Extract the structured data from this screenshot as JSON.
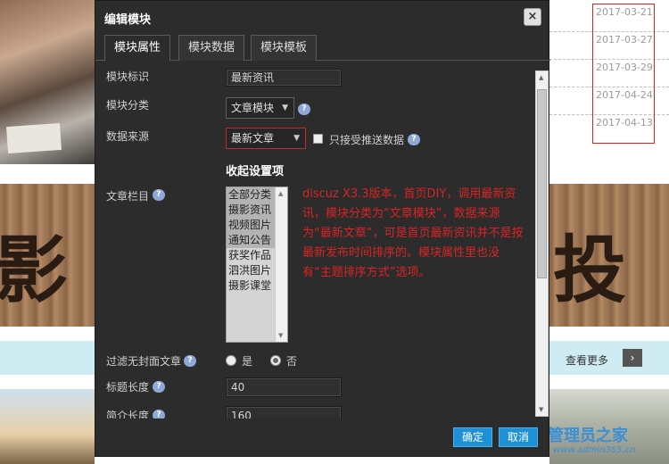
{
  "background": {
    "dates": [
      "2017-03-21",
      "2017-03-27",
      "2017-03-29",
      "2017-04-24",
      "2017-04-13"
    ],
    "banner_chars": [
      "影",
      "〔",
      "投"
    ],
    "more_link": "查看更多",
    "more_icon": "chevron-right-icon",
    "watermark": "管理员之家",
    "watermark_url": "www.admin365.cn"
  },
  "dialog": {
    "title": "编辑模块",
    "close_icon": "close-icon",
    "tabs": [
      {
        "label": "模块属性",
        "active": true
      },
      {
        "label": "模块数据",
        "active": false
      },
      {
        "label": "模块模板",
        "active": false
      }
    ],
    "fields": {
      "module_id_label": "模块标识",
      "module_id_value": "最新资讯",
      "category_label": "模块分类",
      "category_value": "文章模块",
      "source_label": "数据来源",
      "source_value": "最新文章",
      "push_only_label": "只接受推送数据",
      "collapse_title": "收起设置项",
      "article_column_label": "文章栏目",
      "article_columns": [
        "全部分类",
        "摄影资讯",
        "视频图片",
        "通知公告",
        "获奖作品",
        "泗洪图片",
        "摄影课堂"
      ],
      "filter_nocover_label": "过滤无封面文章",
      "radio_yes": "是",
      "radio_no": "否",
      "title_length_label": "标题长度",
      "title_length_value": "40",
      "summary_length_label": "简介长度",
      "summary_length_value": "160"
    },
    "annotation": "discuz X3.3版本，首页DIY，调用最新资讯，模块分类为“文章模块”，数据来源为“最新文章”，可是首页最新资讯并不是按最新发布时间排序的。模块属性里也没有“主题排序方式”选项。",
    "buttons": {
      "confirm": "确定",
      "cancel": "取消"
    },
    "help_icon": "help-icon"
  }
}
